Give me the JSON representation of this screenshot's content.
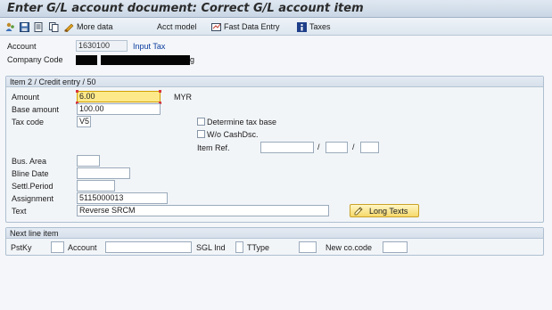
{
  "window": {
    "title": "Enter G/L account document: Correct G/L account item"
  },
  "toolbar": {
    "items": [
      {
        "icon": "person-icon",
        "label": ""
      },
      {
        "icon": "save-icon",
        "label": ""
      },
      {
        "icon": "document-icon",
        "label": ""
      },
      {
        "icon": "copy-icon",
        "label": ""
      },
      {
        "icon": "more-data-icon",
        "label": "More data"
      },
      {
        "icon": "",
        "label": "Acct model"
      },
      {
        "icon": "fast-entry-icon",
        "label": "Fast Data Entry"
      },
      {
        "icon": "info-icon",
        "label": "Taxes"
      }
    ]
  },
  "header": {
    "account_label": "Account",
    "account_value": "1630100",
    "account_desc": "Input Tax",
    "company_code_label": "Company Code",
    "company_code_suffix": "g"
  },
  "item": {
    "title": "Item 2 / Credit entry / 50",
    "amount_label": "Amount",
    "amount_value": "6.00",
    "currency": "MYR",
    "base_amount_label": "Base amount",
    "base_amount_value": "100.00",
    "tax_code_label": "Tax code",
    "tax_code_value": "V5",
    "determine_tax_base": "Determine tax base",
    "wo_cashdsc": "W/o CashDsc.",
    "item_ref_label": "Item Ref.",
    "item_ref_sep": "/",
    "bus_area_label": "Bus. Area",
    "bline_date_label": "Bline Date",
    "settl_period_label": "Settl.Period",
    "assignment_label": "Assignment",
    "assignment_value": "5115000013",
    "text_label": "Text",
    "text_value": "Reverse SRCM",
    "long_texts_label": "Long Texts"
  },
  "next_line": {
    "title": "Next line item",
    "pstky_label": "PstKy",
    "account_label": "Account",
    "sgl_ind_label": "SGL Ind",
    "ttype_label": "TType",
    "new_co_code_label": "New co.code"
  },
  "colors": {
    "title_bar": "#c9d6e4",
    "group_header": "#d6e0eb",
    "highlight_field": "#fde98a",
    "link": "#0a3c9e",
    "button": "#f6d96a"
  }
}
